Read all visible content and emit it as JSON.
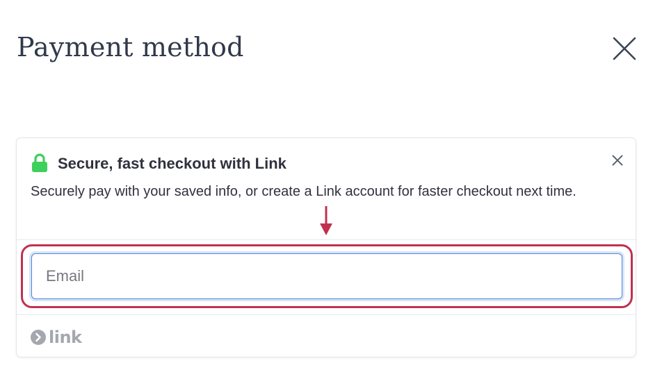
{
  "page": {
    "title": "Payment method"
  },
  "icons": {
    "close": "close-icon",
    "lock": "lock-icon",
    "dismiss": "close-icon",
    "annotation": "arrow-down-icon",
    "link_mark": "chevron-right-circle-icon"
  },
  "colors": {
    "lock_green": "#3ecf5c",
    "annotation_red": "#c0314f",
    "input_focus_blue": "#4f86d9",
    "link_logo_gray": "#a4a7ae"
  },
  "link_card": {
    "title": "Secure, fast checkout with Link",
    "description": "Securely pay with your saved info, or create a Link account for faster checkout next time.",
    "email": {
      "value": "",
      "placeholder": "Email"
    },
    "footer_logo_text": "link"
  }
}
